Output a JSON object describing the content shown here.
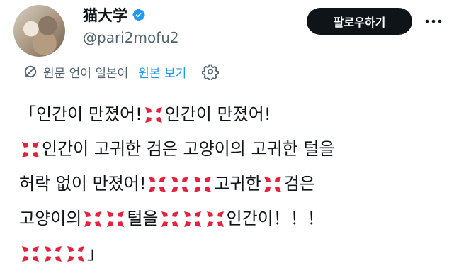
{
  "colors": {
    "verified": "#1d9bf0",
    "link": "#1d9bf0",
    "anger": "#e5223d",
    "follow_bg": "#0f1419"
  },
  "profile": {
    "display_name": "猫大学",
    "handle": "@pari2mofu2",
    "verified_icon": "verified-badge-icon"
  },
  "header": {
    "follow_label": "팔로우하기",
    "more_icon": "more-icon"
  },
  "translation": {
    "icon": "translate-icon",
    "label": "원문 언어 일본어",
    "show_original": "원본 보기",
    "settings_icon": "settings-gear-icon"
  },
  "tweet": {
    "emoji_name": "anger-symbol-icon",
    "lines": [
      [
        "「인간이 만졌어!",
        "E",
        "인간이 만졌어!"
      ],
      [
        "E",
        "인간이 고귀한 검은 고양이의 고귀한 털을"
      ],
      [
        "허락 없이 만졌어!",
        "E",
        "E",
        "E",
        "고귀한",
        "E",
        "검은"
      ],
      [
        "고양이의",
        "E",
        "E",
        "털을",
        "E",
        "E",
        "E",
        "인간이！！！"
      ],
      [
        "E",
        "E",
        "E",
        "」"
      ]
    ]
  }
}
